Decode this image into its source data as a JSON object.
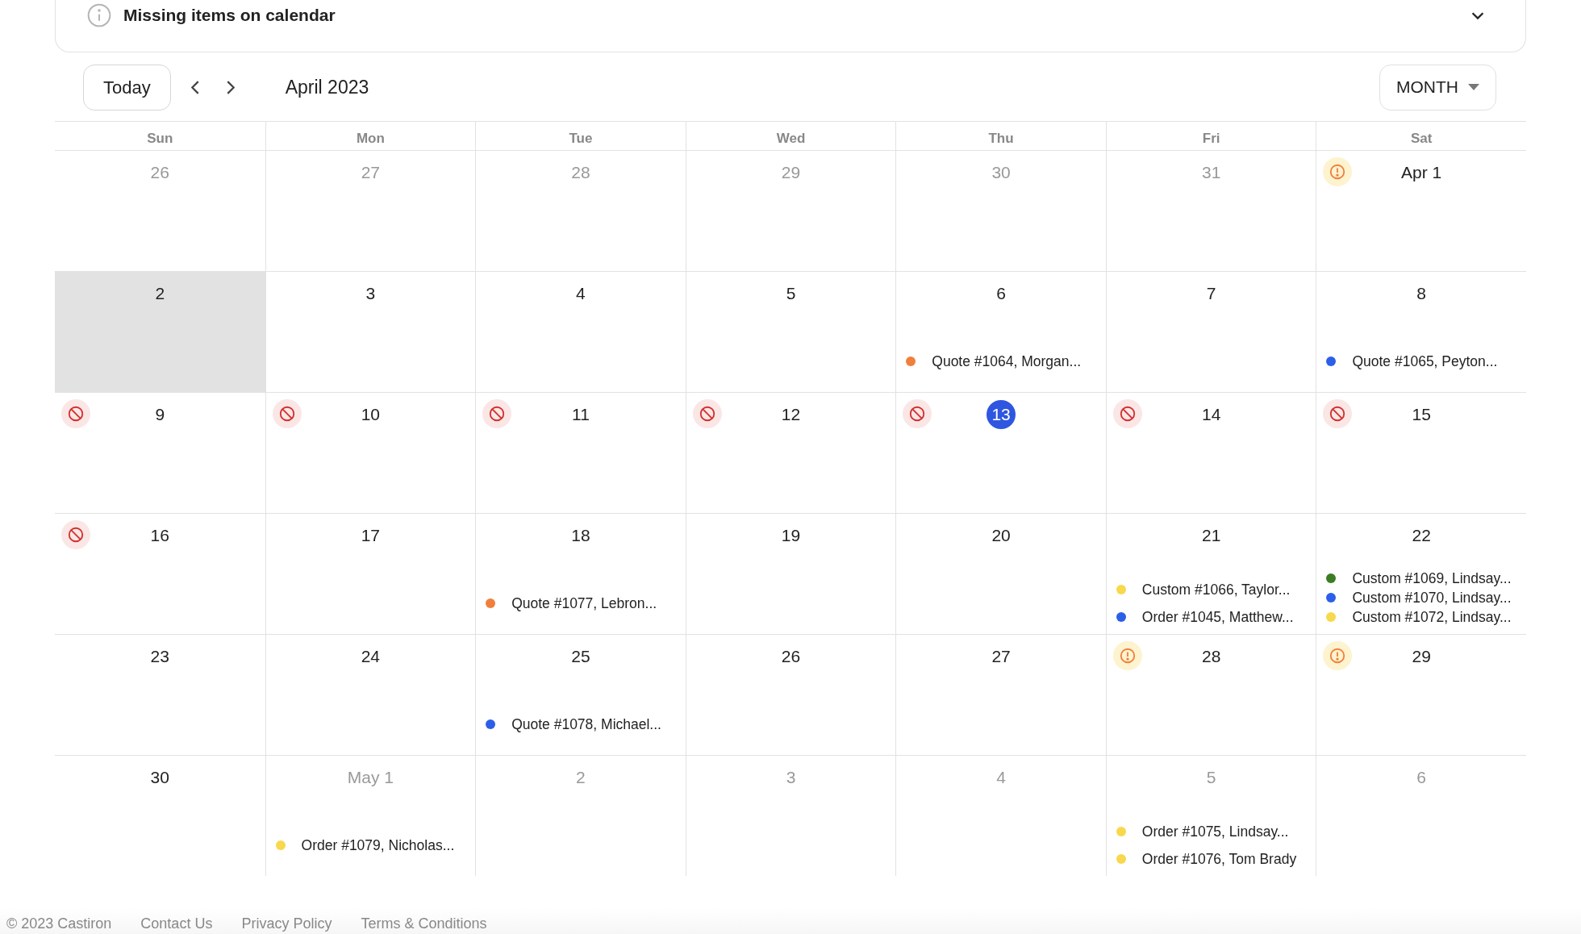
{
  "banner": {
    "title": "Missing items on calendar",
    "expanded": false
  },
  "toolbar": {
    "today_button": "Today",
    "period": "April 2023",
    "view": "MONTH"
  },
  "weekdays": [
    "Sun",
    "Mon",
    "Tue",
    "Wed",
    "Thu",
    "Fri",
    "Sat"
  ],
  "weeks": [
    [
      {
        "label": "26",
        "kind": "other",
        "selected": false,
        "blocked": false,
        "warning": false
      },
      {
        "label": "27",
        "kind": "other",
        "selected": false,
        "blocked": false,
        "warning": false
      },
      {
        "label": "28",
        "kind": "other",
        "selected": false,
        "blocked": false,
        "warning": false
      },
      {
        "label": "29",
        "kind": "other",
        "selected": false,
        "blocked": false,
        "warning": false
      },
      {
        "label": "30",
        "kind": "other",
        "selected": false,
        "blocked": false,
        "warning": false
      },
      {
        "label": "31",
        "kind": "other",
        "selected": false,
        "blocked": false,
        "warning": false
      },
      {
        "label": "Apr 1",
        "kind": "current",
        "selected": false,
        "blocked": false,
        "warning": true
      }
    ],
    [
      {
        "label": "2",
        "kind": "current",
        "selected": true,
        "blocked": false,
        "warning": false
      },
      {
        "label": "3",
        "kind": "current",
        "selected": false,
        "blocked": false,
        "warning": false
      },
      {
        "label": "4",
        "kind": "current",
        "selected": false,
        "blocked": false,
        "warning": false
      },
      {
        "label": "5",
        "kind": "current",
        "selected": false,
        "blocked": false,
        "warning": false
      },
      {
        "label": "6",
        "kind": "current",
        "selected": false,
        "blocked": false,
        "warning": false,
        "events": [
          {
            "text": "Quote #1064, Morgan...",
            "color": "#f07f3c"
          }
        ]
      },
      {
        "label": "7",
        "kind": "current",
        "selected": false,
        "blocked": false,
        "warning": false
      },
      {
        "label": "8",
        "kind": "current",
        "selected": false,
        "blocked": false,
        "warning": false,
        "events": [
          {
            "text": "Quote #1065, Peyton...",
            "color": "#2c5fe8"
          }
        ]
      }
    ],
    [
      {
        "label": "9",
        "kind": "current",
        "selected": false,
        "blocked": true,
        "warning": false
      },
      {
        "label": "10",
        "kind": "current",
        "selected": false,
        "blocked": true,
        "warning": false
      },
      {
        "label": "11",
        "kind": "current",
        "selected": false,
        "blocked": true,
        "warning": false
      },
      {
        "label": "12",
        "kind": "current",
        "selected": false,
        "blocked": true,
        "warning": false
      },
      {
        "label": "13",
        "kind": "today",
        "selected": false,
        "blocked": true,
        "warning": false
      },
      {
        "label": "14",
        "kind": "current",
        "selected": false,
        "blocked": true,
        "warning": false
      },
      {
        "label": "15",
        "kind": "current",
        "selected": false,
        "blocked": true,
        "warning": false
      }
    ],
    [
      {
        "label": "16",
        "kind": "current",
        "selected": false,
        "blocked": true,
        "warning": false
      },
      {
        "label": "17",
        "kind": "current",
        "selected": false,
        "blocked": false,
        "warning": false
      },
      {
        "label": "18",
        "kind": "current",
        "selected": false,
        "blocked": false,
        "warning": false,
        "events": [
          {
            "text": "Quote #1077, Lebron...",
            "color": "#f07f3c"
          }
        ]
      },
      {
        "label": "19",
        "kind": "current",
        "selected": false,
        "blocked": false,
        "warning": false
      },
      {
        "label": "20",
        "kind": "current",
        "selected": false,
        "blocked": false,
        "warning": false
      },
      {
        "label": "21",
        "kind": "current",
        "selected": false,
        "blocked": false,
        "warning": false,
        "events": [
          {
            "text": "Custom #1066, Taylor...",
            "color": "#f8d84c"
          },
          {
            "text": "Order #1045, Matthew...",
            "color": "#2c5fe8"
          }
        ]
      },
      {
        "label": "22",
        "kind": "current",
        "selected": false,
        "blocked": false,
        "warning": false,
        "events": [
          {
            "text": "Custom #1069, Lindsay...",
            "color": "#3a7d22"
          },
          {
            "text": "Custom #1070, Lindsay...",
            "color": "#2c5fe8"
          },
          {
            "text": "Custom #1072, Lindsay...",
            "color": "#f8d84c"
          }
        ]
      }
    ],
    [
      {
        "label": "23",
        "kind": "current",
        "selected": false,
        "blocked": false,
        "warning": false
      },
      {
        "label": "24",
        "kind": "current",
        "selected": false,
        "blocked": false,
        "warning": false
      },
      {
        "label": "25",
        "kind": "current",
        "selected": false,
        "blocked": false,
        "warning": false,
        "events": [
          {
            "text": "Quote #1078, Michael...",
            "color": "#2c5fe8"
          }
        ]
      },
      {
        "label": "26",
        "kind": "current",
        "selected": false,
        "blocked": false,
        "warning": false
      },
      {
        "label": "27",
        "kind": "current",
        "selected": false,
        "blocked": false,
        "warning": false
      },
      {
        "label": "28",
        "kind": "current",
        "selected": false,
        "blocked": false,
        "warning": true
      },
      {
        "label": "29",
        "kind": "current",
        "selected": false,
        "blocked": false,
        "warning": true
      }
    ],
    [
      {
        "label": "30",
        "kind": "current",
        "selected": false,
        "blocked": false,
        "warning": false
      },
      {
        "label": "May 1",
        "kind": "other",
        "selected": false,
        "blocked": false,
        "warning": false,
        "events": [
          {
            "text": "Order #1079, Nicholas...",
            "color": "#f8d84c"
          }
        ]
      },
      {
        "label": "2",
        "kind": "other",
        "selected": false,
        "blocked": false,
        "warning": false
      },
      {
        "label": "3",
        "kind": "other",
        "selected": false,
        "blocked": false,
        "warning": false
      },
      {
        "label": "4",
        "kind": "other",
        "selected": false,
        "blocked": false,
        "warning": false
      },
      {
        "label": "5",
        "kind": "other",
        "selected": false,
        "blocked": false,
        "warning": false,
        "events": [
          {
            "text": "Order #1075, Lindsay...",
            "color": "#f8d84c"
          },
          {
            "text": "Order #1076, Tom Brady",
            "color": "#f8d84c"
          }
        ]
      },
      {
        "label": "6",
        "kind": "other",
        "selected": false,
        "blocked": false,
        "warning": false
      }
    ]
  ],
  "footer": {
    "copyright": "© 2023 Castiron",
    "links": [
      "Contact Us",
      "Privacy Policy",
      "Terms & Conditions"
    ]
  }
}
